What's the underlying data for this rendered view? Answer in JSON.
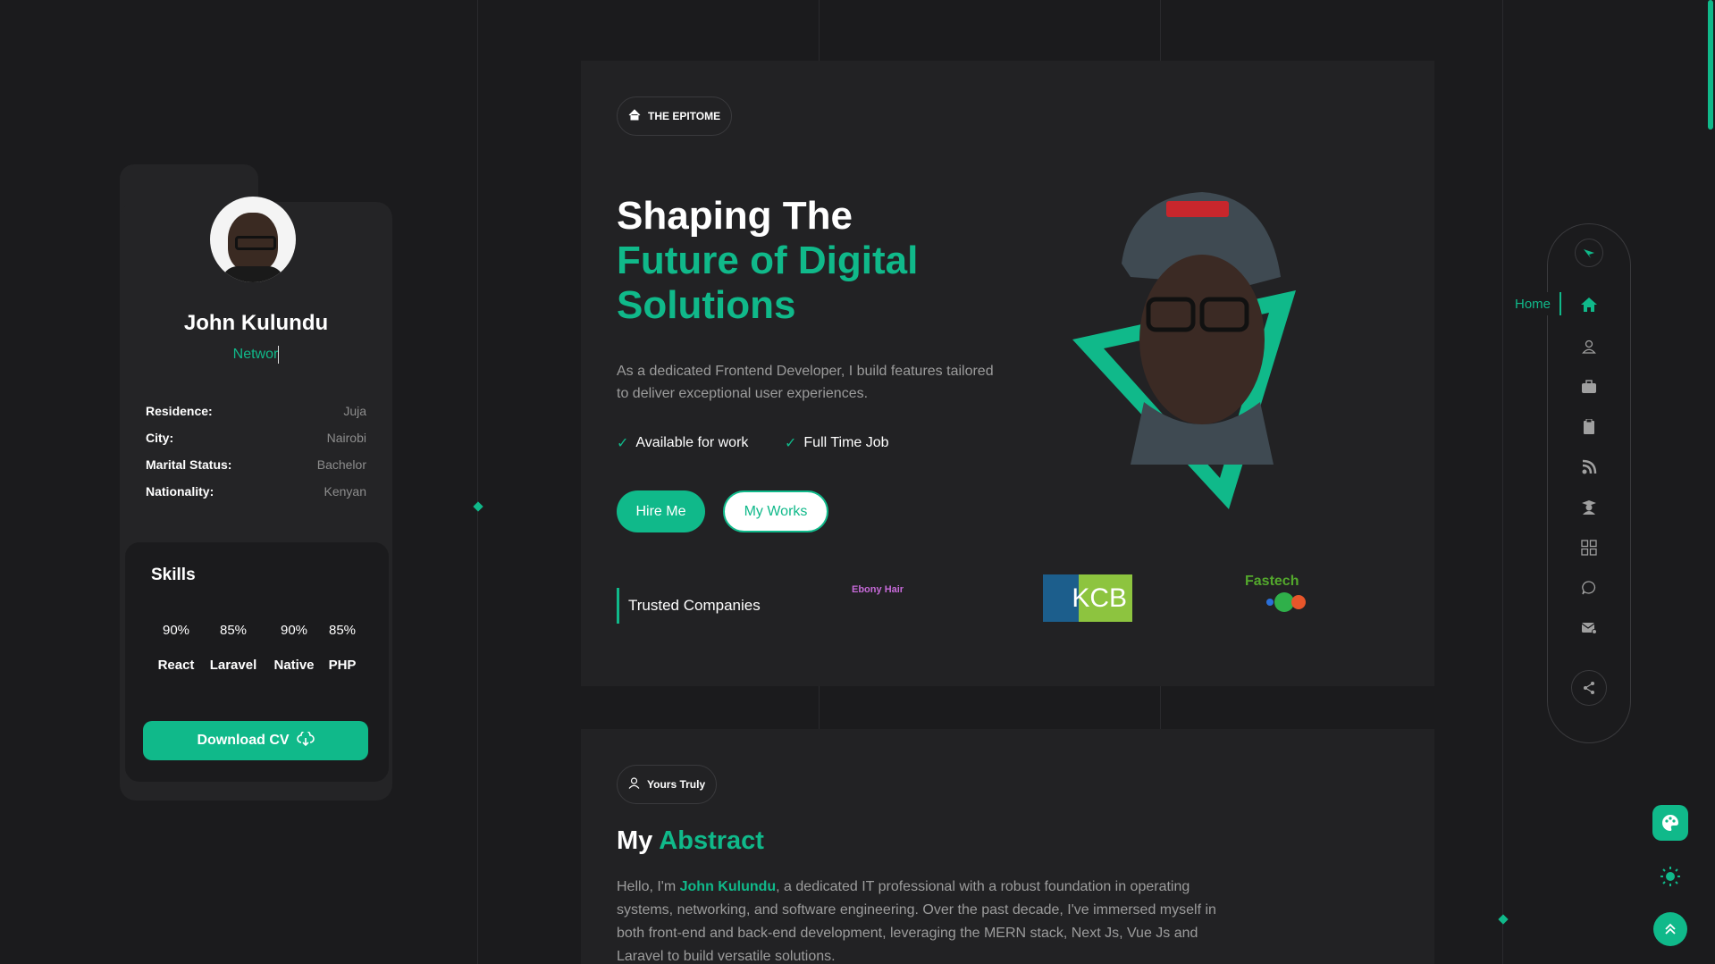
{
  "colors": {
    "accent": "#10b98a",
    "background": "#1b1b1d",
    "card": "#242426"
  },
  "profile": {
    "name": "John Kulundu",
    "role_typing": "Networ",
    "details": [
      {
        "label": "Residence:",
        "value": "Juja"
      },
      {
        "label": "City:",
        "value": "Nairobi"
      },
      {
        "label": "Marital Status:",
        "value": "Bachelor"
      },
      {
        "label": "Nationality:",
        "value": "Kenyan"
      }
    ],
    "skills_title": "Skills",
    "skills": [
      {
        "percent": "90%",
        "name": "React"
      },
      {
        "percent": "85%",
        "name": "Laravel"
      },
      {
        "percent": "90%",
        "name": "Native"
      },
      {
        "percent": "85%",
        "name": "PHP"
      }
    ],
    "download_label": "Download CV"
  },
  "hero": {
    "chip": "THE EPITOME",
    "title_line1": "Shaping The",
    "title_line2": "Future of Digital",
    "title_line3": "Solutions",
    "description": "As a dedicated Frontend Developer, I build features tailored to deliver exceptional user experiences.",
    "features": [
      "Available for work",
      "Full Time Job"
    ],
    "hire_label": "Hire Me",
    "works_label": "My Works",
    "trusted_label": "Trusted Companies",
    "companies": {
      "ebony": "Ebony",
      "ebony_accent": "Hair",
      "kcb": "KCB",
      "fastech": "Fastech"
    }
  },
  "abstract": {
    "chip": "Yours Truly",
    "title_plain": "My",
    "title_accent": "Abstract",
    "text_before": "Hello, I'm ",
    "name": "John Kulundu",
    "text_after": ", a dedicated IT professional with a robust foundation in operating systems, networking, and software engineering. Over the past decade, I've immersed myself in both front-end and back-end development, leveraging the MERN stack, Next Js, Vue Js and Laravel to build versatile solutions."
  },
  "nav": {
    "home_label": "Home",
    "icons": [
      "logo-icon",
      "home-icon",
      "user-icon",
      "briefcase-icon",
      "clipboard-icon",
      "blog-icon",
      "graduate-icon",
      "grid-icon",
      "chat-icon",
      "mail-icon",
      "share-icon"
    ]
  }
}
